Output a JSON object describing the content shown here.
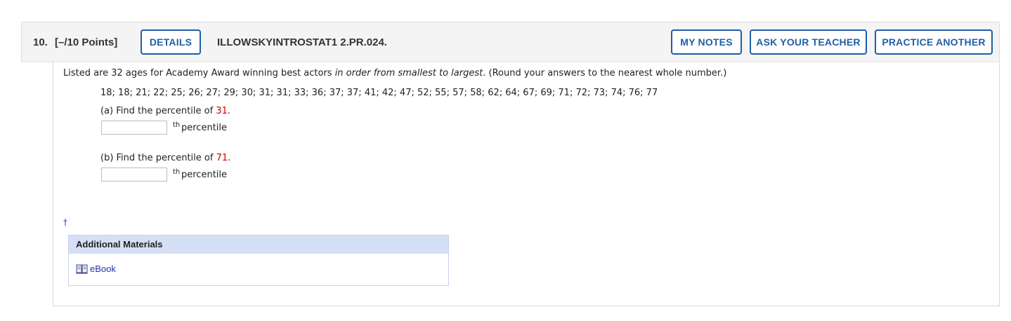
{
  "header": {
    "number": "10.",
    "points": "[–/10 Points]",
    "details_label": "DETAILS",
    "code": "ILLOWSKYINTROSTAT1 2.PR.024.",
    "my_notes_label": "MY NOTES",
    "ask_teacher_label": "ASK YOUR TEACHER",
    "practice_label": "PRACTICE ANOTHER"
  },
  "question": {
    "intro_a": "Listed are 32 ages for Academy Award winning best actors ",
    "intro_italic": "in order from smallest to largest",
    "intro_b": ". (Round your answers to the nearest whole number.)",
    "data_list": "18; 18; 21; 22; 25; 26; 27; 29; 30; 31; 31; 33; 36; 37; 37; 41; 42; 47; 52; 55; 57; 58; 62; 64; 67; 69; 71; 72; 73; 74; 76; 77",
    "part_a": {
      "prompt": "(a) Find the percentile of ",
      "value": "31",
      "period": ".",
      "suffix_sup": "th",
      "suffix": " percentile",
      "answer": ""
    },
    "part_b": {
      "prompt": "(b) Find the percentile of ",
      "value": "71",
      "period": ".",
      "suffix_sup": "th",
      "suffix": " percentile",
      "answer": ""
    }
  },
  "dagger": "†",
  "additional_materials": {
    "title": "Additional Materials",
    "ebook_label": "eBook"
  }
}
